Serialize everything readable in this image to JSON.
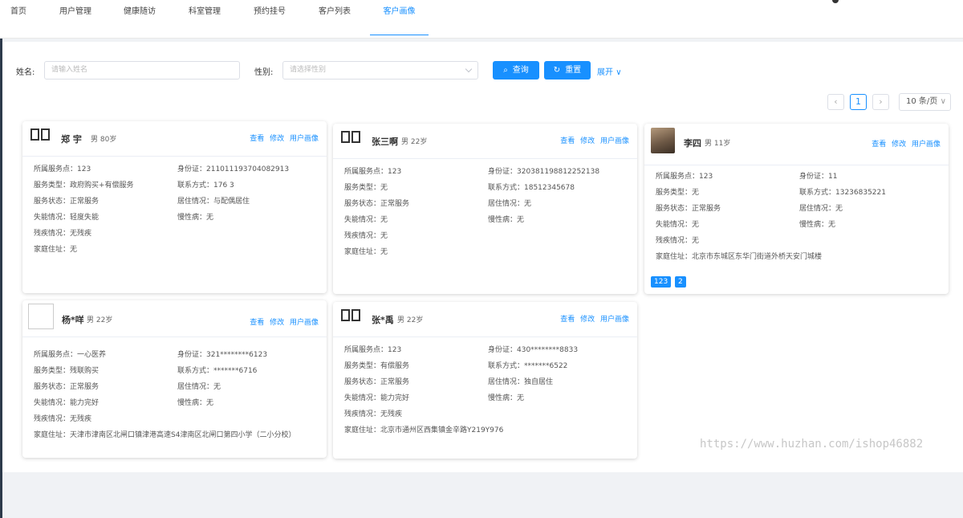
{
  "nav": {
    "items": [
      "首页",
      "用户管理",
      "健康随访",
      "科室管理",
      "预约挂号",
      "客户列表",
      "客户画像"
    ],
    "active_index": 6
  },
  "search": {
    "name_label": "姓名:",
    "name_placeholder": "请输入姓名",
    "gender_label": "性别:",
    "gender_placeholder": "请选择性别",
    "query_button": "查询",
    "reset_button": "重置",
    "expand_label": "展开"
  },
  "pager": {
    "prev": "‹",
    "current": "1",
    "next": "›",
    "page_size": "10 条/页"
  },
  "card_actions": {
    "view": "查看",
    "edit": "修改",
    "portrait": "用户画像"
  },
  "cards": [
    {
      "name": "郑  宇",
      "meta": "男 80岁",
      "service_point": "所属服务点：123",
      "id_card": "身份证：211011193704082913",
      "service_type": "服务类型：政府购买+有偿服务",
      "contact": "联系方式：176          3",
      "service_status": "服务状态：正常服务",
      "living": "居住情况：与配偶居住",
      "disability": "失能情况：轻度失能",
      "chronic": "慢性病：无",
      "handicap": "残疾情况：无残疾",
      "address": "家庭住址：无"
    },
    {
      "name": "张三啊",
      "meta": "男 22岁",
      "service_point": "所属服务点：123",
      "id_card": "身份证：320381198812252138",
      "service_type": "服务类型：无",
      "contact": "联系方式：18512345678",
      "service_status": "服务状态：正常服务",
      "living": "居住情况：无",
      "disability": "失能情况：无",
      "chronic": "慢性病：无",
      "handicap": "残疾情况：无",
      "address": "家庭住址：无"
    },
    {
      "name": "李四",
      "meta": "男 11岁",
      "service_point": "所属服务点：123",
      "id_card": "身份证：11",
      "service_type": "服务类型：无",
      "contact": "联系方式：13236835221",
      "service_status": "服务状态：正常服务",
      "living": "居住情况：无",
      "disability": "失能情况：无",
      "chronic": "慢性病：无",
      "handicap": "残疾情况：无",
      "address": "家庭住址：北京市东城区东华门街道外桥天安门城楼",
      "tags": [
        "123",
        "2"
      ]
    },
    {
      "name": "杨*咩",
      "meta": "男 22岁",
      "service_point": "所属服务点：一心医养",
      "id_card": "身份证：321********6123",
      "service_type": "服务类型：残联购买",
      "contact": "联系方式：*******6716",
      "service_status": "服务状态：正常服务",
      "living": "居住情况：无",
      "disability": "失能情况：能力完好",
      "chronic": "慢性病：无",
      "handicap": "残疾情况：无残疾",
      "address": "家庭住址：天津市津南区北闸口镇津港高速S4津南区北闸口第四小学（二小分校）"
    },
    {
      "name": "张*禹",
      "meta": "男 22岁",
      "service_point": "所属服务点：123",
      "id_card": "身份证：430********8833",
      "service_type": "服务类型：有偿服务",
      "contact": "联系方式：*******6522",
      "service_status": "服务状态：正常服务",
      "living": "居住情况：独自居住",
      "disability": "失能情况：能力完好",
      "chronic": "慢性病：无",
      "handicap": "残疾情况：无残疾",
      "address": "家庭住址：北京市通州区西集镇金辛路Y219Y976"
    }
  ],
  "watermark": "https://www.huzhan.com/ishop46882"
}
